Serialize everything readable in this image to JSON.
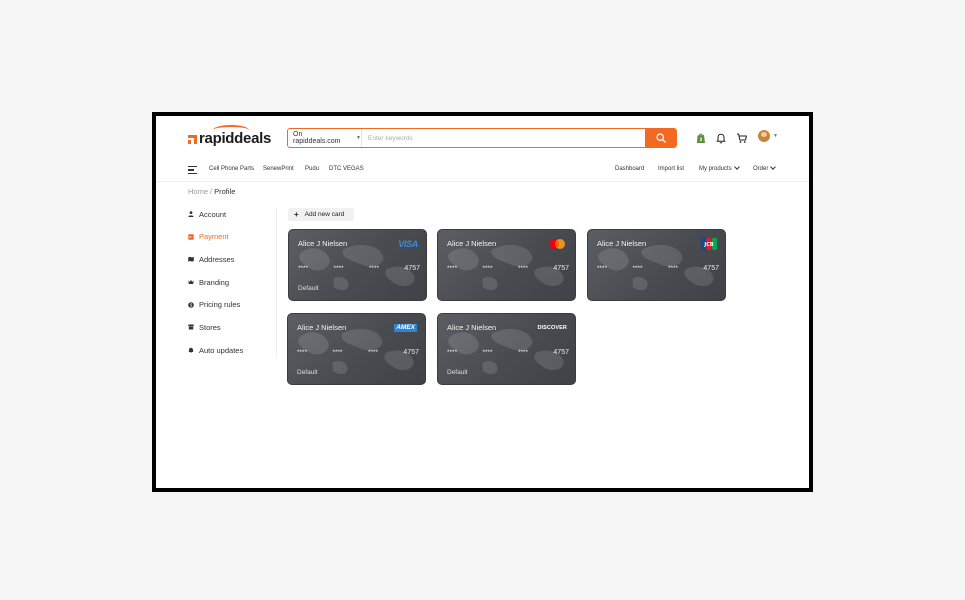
{
  "brand": {
    "name": "rapiddeals",
    "accent": "#f26a21"
  },
  "search": {
    "scope": "On rapiddeals.com",
    "placeholder": "Enter keywords"
  },
  "header_icons": [
    "shopify-icon",
    "bell-icon",
    "cart-icon",
    "avatar"
  ],
  "nav": {
    "left": [
      "Cell Phone Parts",
      "SenewPrint",
      "Pudu",
      "DTC VEGAS"
    ],
    "right": {
      "dashboard": "Dashboard",
      "import": "Import list",
      "products": "My products",
      "order": "Order"
    }
  },
  "breadcrumb": {
    "home": "Home",
    "sep": "/",
    "current": "Profile"
  },
  "sidebar": {
    "items": [
      {
        "label": "Account",
        "icon": "user-icon"
      },
      {
        "label": "Payment",
        "icon": "payment-icon",
        "active": true
      },
      {
        "label": "Addresses",
        "icon": "map-icon"
      },
      {
        "label": "Branding",
        "icon": "crown-icon"
      },
      {
        "label": "Pricing rules",
        "icon": "dollar-icon"
      },
      {
        "label": "Stores",
        "icon": "store-icon"
      },
      {
        "label": "Auto updates",
        "icon": "bell-icon"
      }
    ]
  },
  "add_card": {
    "label": "Add new card"
  },
  "cards": [
    {
      "holder": "Alice J Nielsen",
      "brand": "VISA",
      "mask": "****",
      "last4": "4757",
      "default_label": "Default"
    },
    {
      "holder": "Alice J Nielsen",
      "brand": "mastercard",
      "mask": "****",
      "last4": "4757",
      "default_label": ""
    },
    {
      "holder": "Alice J Nielsen",
      "brand": "JCB",
      "mask": "****",
      "last4": "4757",
      "default_label": ""
    },
    {
      "holder": "Alice J Nielsen",
      "brand": "AMEX",
      "mask": "****",
      "last4": "4757",
      "default_label": "Default"
    },
    {
      "holder": "Alice J Nielsen",
      "brand": "DISCOVER",
      "mask": "****",
      "last4": "4757",
      "default_label": "Default"
    }
  ]
}
